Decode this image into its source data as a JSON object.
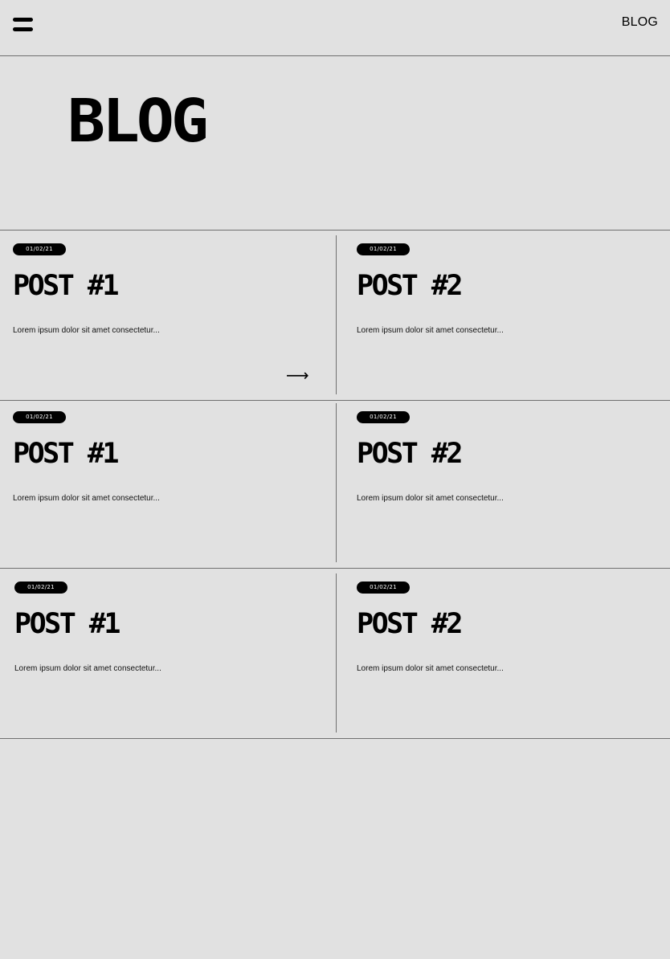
{
  "nav": {
    "link_label": "BLOG"
  },
  "hero": {
    "title": "BLOG"
  },
  "rows": [
    {
      "left": {
        "date": "01/02/21",
        "title": "POST #1",
        "excerpt": "Lorem ipsum dolor sit amet consectetur..."
      },
      "right": {
        "date": "01/02/21",
        "title": "POST #2",
        "excerpt": "Lorem ipsum dolor sit amet consectetur..."
      },
      "arrow": "⟶"
    },
    {
      "left": {
        "date": "01/02/21",
        "title": "POST #1",
        "excerpt": "Lorem ipsum dolor sit amet consectetur..."
      },
      "right": {
        "date": "01/02/21",
        "title": "POST #2",
        "excerpt": "Lorem ipsum dolor sit amet consectetur..."
      }
    },
    {
      "left": {
        "date": "01/02/21",
        "title": "POST #1",
        "excerpt": "Lorem ipsum dolor sit amet consectetur..."
      },
      "right": {
        "date": "01/02/21",
        "title": "POST #2",
        "excerpt": "Lorem ipsum dolor sit amet consectetur..."
      }
    }
  ]
}
